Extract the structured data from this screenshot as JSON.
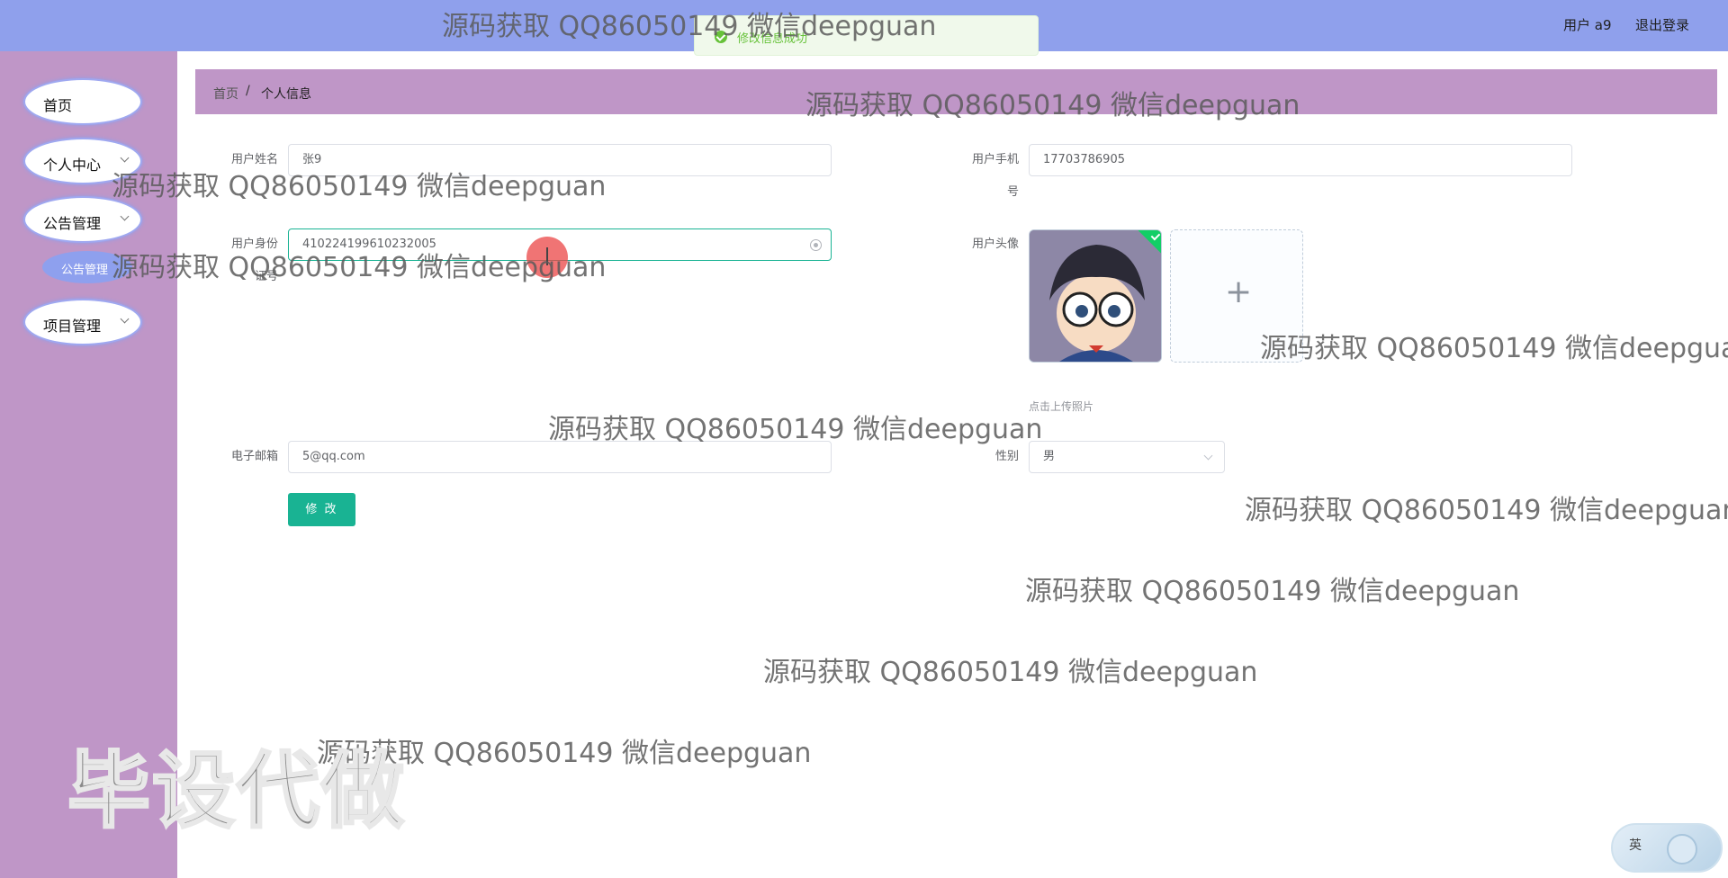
{
  "header": {
    "user_label": "用户 a9",
    "logout_label": "退出登录"
  },
  "toast": {
    "message": "修改信息成功"
  },
  "sidebar": {
    "items": [
      {
        "label": "首页"
      },
      {
        "label": "个人中心"
      },
      {
        "label": "公告管理"
      },
      {
        "label": "公告管理"
      },
      {
        "label": "项目管理"
      }
    ]
  },
  "breadcrumb": {
    "home": "首页",
    "separator": "/",
    "current": "个人信息"
  },
  "form": {
    "name_label": "用户姓名",
    "name_value": "张9",
    "phone_label_1": "用户手机",
    "phone_label_2": "号",
    "phone_value": "17703786905",
    "id_label_1": "用户身份",
    "id_label_2": "证号",
    "id_value": "410224199610232005",
    "avatar_label": "用户头像",
    "upload_plus": "+",
    "upload_tip": "点击上传照片",
    "email_label": "电子邮箱",
    "email_value": "5@qq.com",
    "gender_label": "性别",
    "gender_value": "男",
    "submit_label": "修 改"
  },
  "watermarks": {
    "text": "源码获取 QQ86050149 微信deepguan",
    "big_text": "毕设代做"
  },
  "ime": {
    "label": "英"
  },
  "colors": {
    "topbar": "#8fa0ec",
    "sidebar": "#bf96c7",
    "primary_button": "#19b393",
    "success": "#67c23a"
  }
}
